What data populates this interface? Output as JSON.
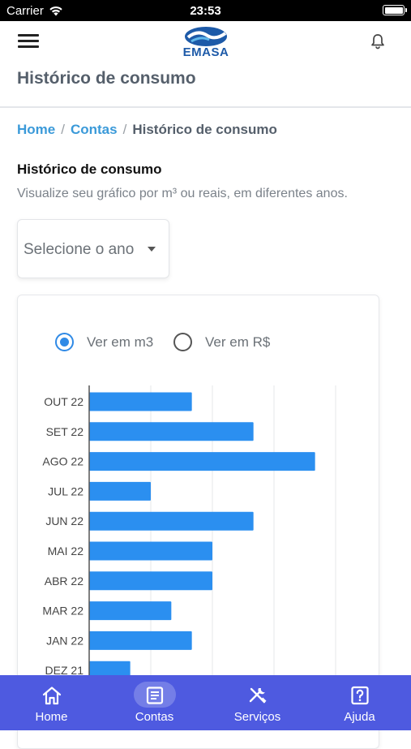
{
  "status_bar": {
    "carrier": "Carrier",
    "time": "23:53"
  },
  "header": {
    "logo_text": "EMASA"
  },
  "page": {
    "title": "Histórico de consumo"
  },
  "breadcrumb": {
    "home": "Home",
    "contas": "Contas",
    "current": "Histórico de consumo",
    "separator": "/"
  },
  "section": {
    "title": "Histórico de consumo",
    "subtitle": "Visualize seu gráfico por m³ ou reais, em diferentes anos."
  },
  "year_select": {
    "placeholder": "Selecione o ano"
  },
  "unit_toggle": {
    "options": [
      {
        "label": "Ver em m3",
        "selected": true
      },
      {
        "label": "Ver em R$",
        "selected": false
      }
    ]
  },
  "chart_data": {
    "type": "bar",
    "orientation": "horizontal",
    "categories": [
      "OUT 22",
      "SET 22",
      "AGO 22",
      "JUL 22",
      "JUN 22",
      "MAI 22",
      "ABR 22",
      "MAR 22",
      "JAN 22",
      "DEZ 21"
    ],
    "values": [
      5,
      8,
      11,
      3,
      8,
      6,
      6,
      4,
      5,
      2
    ],
    "xlim": [
      0,
      12
    ],
    "grid": true,
    "bar_color": "#2b8ff0"
  },
  "tab_bar": {
    "background": "#4e5ae0",
    "items": [
      {
        "label": "Home",
        "icon": "home-icon",
        "active": false
      },
      {
        "label": "Contas",
        "icon": "document-icon",
        "active": true
      },
      {
        "label": "Serviços",
        "icon": "tools-icon",
        "active": false
      },
      {
        "label": "Ajuda",
        "icon": "help-icon",
        "active": false
      }
    ]
  }
}
